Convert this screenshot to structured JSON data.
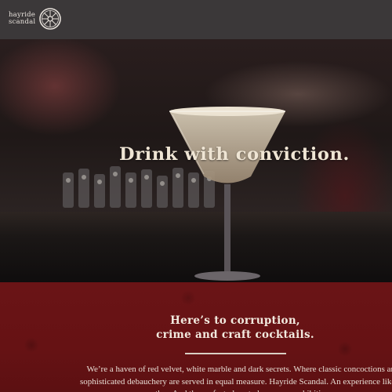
{
  "header": {
    "logo_line1": "hayride",
    "logo_line2": "scandal",
    "logo_icon": "wagon-wheel-icon"
  },
  "hero": {
    "headline": "Drink with conviction."
  },
  "about": {
    "title_line1": "Here’s to corruption,",
    "title_line2": "crime and craft cocktails.",
    "body": "We’re a haven of red velvet, white marble and dark secrets. Where classic concoctions and sophisticated debauchery are served in equal measure. Hayride Scandal. An experience like no other. And the perfect place to lose your prohibitions."
  },
  "colors": {
    "header_bg": "#3b3839",
    "section_red": "#661214",
    "headline": "#efe5d4"
  }
}
